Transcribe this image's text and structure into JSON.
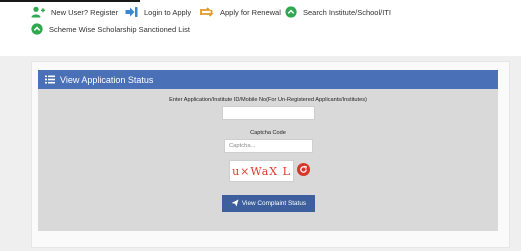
{
  "menu": {
    "items": [
      {
        "label": "New User? Register",
        "icon": "add-user-icon"
      },
      {
        "label": "Login to Apply",
        "icon": "login-icon"
      },
      {
        "label": "Apply for Renewal",
        "icon": "renewal-icon"
      },
      {
        "label": "Search Institute/School/ITI",
        "icon": "chevron-up-circle-icon"
      },
      {
        "label": "Scheme Wise Scholarship Sanctioned List",
        "icon": "chevron-up-circle-icon"
      }
    ]
  },
  "panel": {
    "title": "View Application Status",
    "id_label": "Enter Application/Institute ID/Mobile No(For Un-Registered Applicants/Institutes)",
    "id_value": "",
    "captcha_label": "Captcha Code",
    "captcha_placeholder": "Captcha...",
    "captcha_text": "u×WaX L",
    "submit_label": "View Complaint Status"
  },
  "colors": {
    "header_blue": "#4a70b8",
    "button_blue": "#3d5f9e",
    "icon_green": "#2fa84f",
    "icon_orange": "#e39a2c",
    "refresh_red": "#d9362b"
  }
}
